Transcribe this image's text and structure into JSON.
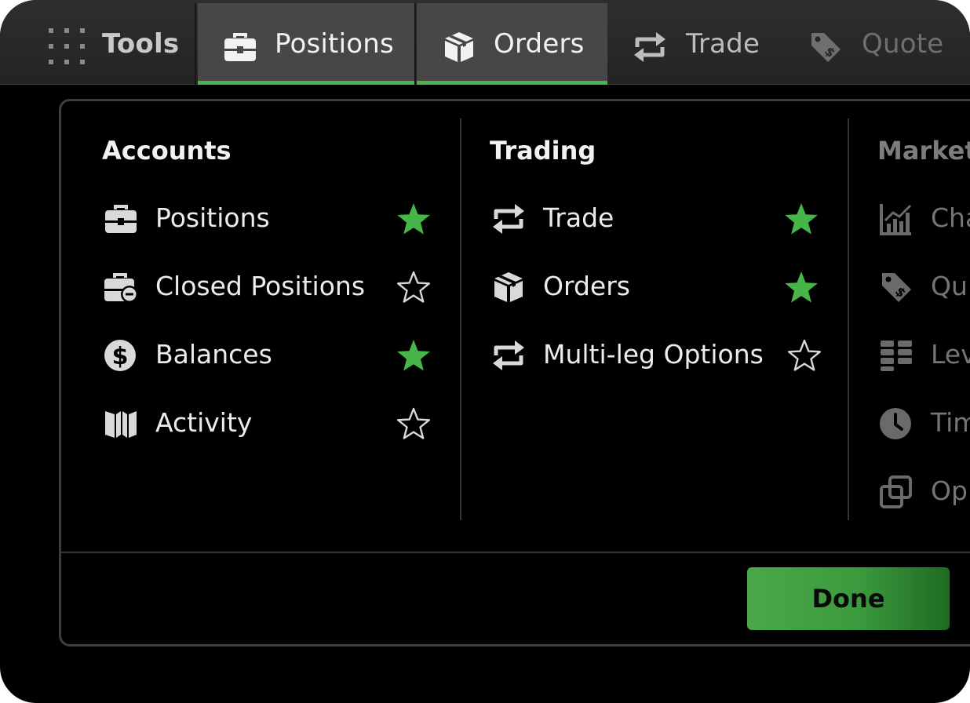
{
  "tabs": [
    {
      "label": "Tools",
      "icon": "grid-dots-icon"
    },
    {
      "label": "Positions",
      "icon": "briefcase-icon",
      "active": true
    },
    {
      "label": "Orders",
      "icon": "box-icon",
      "active": true
    },
    {
      "label": "Trade",
      "icon": "swap-arrows-icon"
    },
    {
      "label": "Quote",
      "icon": "price-tag-icon"
    }
  ],
  "columns": [
    {
      "heading": "Accounts",
      "items": [
        {
          "label": "Positions",
          "icon": "briefcase-icon",
          "favorite": true
        },
        {
          "label": "Closed Positions",
          "icon": "briefcase-minus-icon",
          "favorite": false
        },
        {
          "label": "Balances",
          "icon": "dollar-circle-icon",
          "favorite": true
        },
        {
          "label": "Activity",
          "icon": "open-book-icon",
          "favorite": false
        }
      ]
    },
    {
      "heading": "Trading",
      "items": [
        {
          "label": "Trade",
          "icon": "swap-arrows-icon",
          "favorite": true
        },
        {
          "label": "Orders",
          "icon": "box-icon",
          "favorite": true
        },
        {
          "label": "Multi-leg Options",
          "icon": "swap-arrows-icon",
          "favorite": false
        }
      ]
    },
    {
      "heading": "Market",
      "items": [
        {
          "label": "Cha",
          "icon": "chart-icon"
        },
        {
          "label": "Qu",
          "icon": "price-tag-icon"
        },
        {
          "label": "Lev",
          "icon": "level-grid-icon"
        },
        {
          "label": "Tim",
          "icon": "clock-icon"
        },
        {
          "label": "Op",
          "icon": "overlap-squares-icon"
        }
      ]
    }
  ],
  "done_label": "Done",
  "colors": {
    "accent": "#47b548",
    "star_filled": "#47b548",
    "star_outline": "#d9d9d9",
    "background": "#000000"
  }
}
